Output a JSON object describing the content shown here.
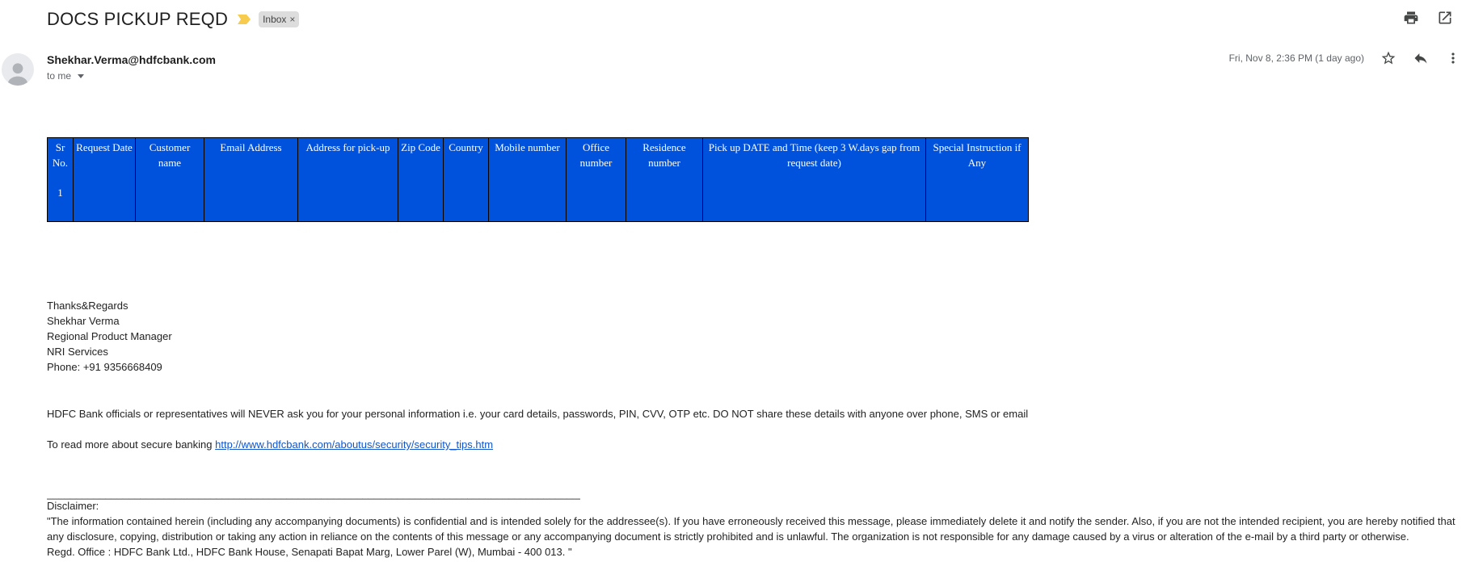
{
  "email": {
    "subject": "DOCS PICKUP REQD",
    "label": "Inbox",
    "sender": "Shekhar.Verma@hdfcbank.com",
    "to": "to me",
    "date": "Fri, Nov 8, 2:36 PM (1 day ago)"
  },
  "table": {
    "headers": [
      "Sr No.",
      "Request Date",
      "Customer name",
      "Email Address",
      "Address for pick-up",
      "Zip Code",
      "Country",
      "Mobile number",
      "Office number",
      "Residence number",
      "Pick up DATE and Time (keep 3 W.days gap from request date)",
      "Special Instruction if Any"
    ],
    "row_sr": "1"
  },
  "signature": {
    "line1": "Thanks&Regards",
    "line2": "Shekhar Verma",
    "line3": "Regional Product Manager",
    "line4": "NRI Services",
    "line5": "Phone: +91 9356668409"
  },
  "warning": "HDFC Bank officials or representatives will NEVER ask you for your personal information i.e. your card details, passwords, PIN, CVV, OTP etc. DO NOT share these details with anyone over phone, SMS or email",
  "readmore": {
    "prefix": "To read more about secure banking ",
    "link": "http://www.hdfcbank.com/aboutus/security/security_tips.htm"
  },
  "rule": "____________________________________________________________________________________________________________",
  "disclaimer": {
    "title": "Disclaimer:",
    "text": "\"The information contained herein (including any accompanying documents) is confidential and is intended solely for the addressee(s). If you have erroneously received this message, please immediately delete it and notify the sender. Also, if you are not the intended recipient, you are hereby notified that any disclosure, copying, distribution or taking any action in reliance on the contents of this message or any accompanying document is strictly prohibited and is unlawful. The organization is not responsible for any damage caused by a virus or alteration of the e-mail by a third party or otherwise.",
    "office": "Regd. Office : HDFC Bank Ltd., HDFC Bank House, Senapati Bapat Marg, Lower Parel (W), Mumbai - 400 013. \""
  },
  "icons": {
    "importance": "importance-marker-icon",
    "print": "print-icon",
    "open_new_window": "open-in-new-window-icon",
    "star": "star-icon",
    "reply": "reply-icon",
    "more": "more-vertical-icon",
    "avatar": "default-avatar-icon"
  },
  "colors": {
    "table_bg": "#0052dc",
    "link": "#1155cc",
    "importance": "#f7cb4d"
  }
}
